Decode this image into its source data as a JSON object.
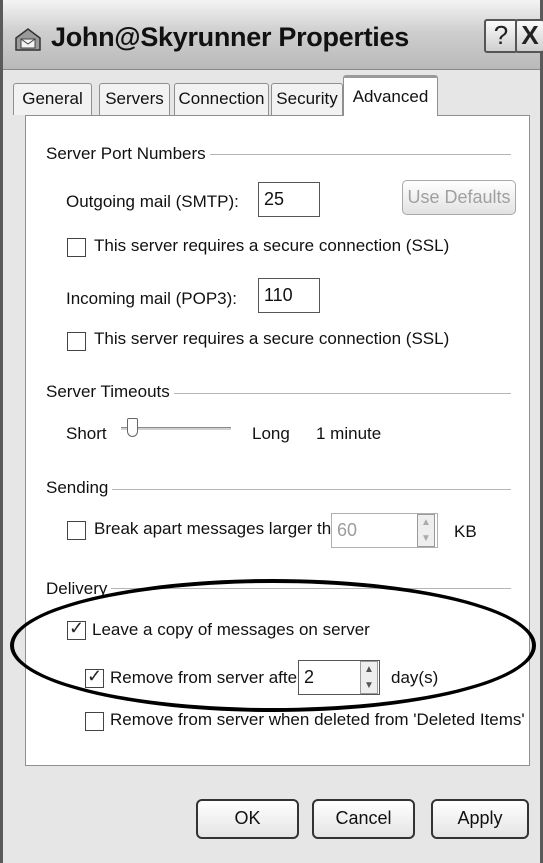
{
  "window": {
    "title": "John@Skyrunner Properties",
    "help_symbol": "?",
    "close_symbol": "X",
    "icon": "mail-account-icon"
  },
  "tabs": [
    {
      "label": "General",
      "active": false
    },
    {
      "label": "Servers",
      "active": false
    },
    {
      "label": "Connection",
      "active": false
    },
    {
      "label": "Security",
      "active": false
    },
    {
      "label": "Advanced",
      "active": true
    }
  ],
  "server_ports": {
    "group_label": "Server Port Numbers",
    "outgoing_label": "Outgoing mail (SMTP):",
    "outgoing_value": "25",
    "use_defaults_label": "Use Defaults",
    "outgoing_ssl_label": "This server requires a secure connection (SSL)",
    "outgoing_ssl_checked": false,
    "incoming_label": "Incoming mail (POP3):",
    "incoming_value": "110",
    "incoming_ssl_label": "This server requires a secure connection (SSL)",
    "incoming_ssl_checked": false
  },
  "timeouts": {
    "group_label": "Server Timeouts",
    "short_label": "Short",
    "long_label": "Long",
    "value_text": "1 minute",
    "slider_level": 0.1
  },
  "sending": {
    "group_label": "Sending",
    "break_apart_label": "Break apart messages larger than",
    "break_apart_checked": false,
    "size_value": "60",
    "unit_label": "KB"
  },
  "delivery": {
    "group_label": "Delivery",
    "leave_copy_label": "Leave a copy of messages on server",
    "leave_copy_checked": true,
    "remove_after_label": "Remove from server after",
    "remove_after_checked": true,
    "days_value": "2",
    "days_unit": "day(s)",
    "remove_deleted_label": "Remove from server when deleted from 'Deleted Items'",
    "remove_deleted_checked": false
  },
  "buttons": {
    "ok": "OK",
    "cancel": "Cancel",
    "apply": "Apply"
  }
}
